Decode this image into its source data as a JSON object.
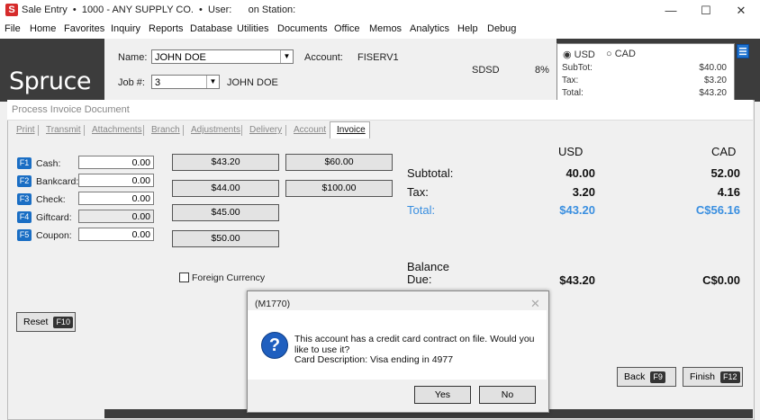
{
  "window": {
    "title": "Sale Entry  •  1000 - ANY SUPPLY CO.  •  User:      on Station:",
    "app_icon": "S",
    "controls": [
      "—",
      "☐",
      "✕"
    ]
  },
  "menu": [
    "File",
    "Home",
    "Favorites",
    "Inquiry",
    "Reports",
    "Database",
    "Utilities",
    "Documents",
    "Office",
    "Memos",
    "Analytics",
    "Help",
    "Debug"
  ],
  "logo": "Spruce",
  "header": {
    "name_label": "Name:",
    "name_value": "JOHN DOE",
    "account_label": "Account:",
    "account_value": "FISERV1",
    "job_label": "Job #:",
    "job_value": "3",
    "job_name": "JOHN DOE",
    "code": "SDSD",
    "tax_rate": "8%"
  },
  "currency": {
    "usd_label": "USD",
    "cad_label": "CAD",
    "selected": "USD",
    "subtot_label": "SubTot:",
    "subtot_value": "$40.00",
    "tax_label": "Tax:",
    "tax_value": "$3.20",
    "total_label": "Total:",
    "total_value": "$43.20"
  },
  "panel": {
    "title": "Process Invoice Document",
    "tabs": [
      "Print",
      "Transmit",
      "Attachments",
      "Branch",
      "Adjustments",
      "Delivery",
      "Account",
      "Invoice"
    ],
    "active_tab": "Invoice"
  },
  "payments": [
    {
      "key": "F1",
      "label": "Cash:",
      "value": "0.00"
    },
    {
      "key": "F2",
      "label": "Bankcard:",
      "value": "0.00"
    },
    {
      "key": "F3",
      "label": "Check:",
      "value": "0.00"
    },
    {
      "key": "F4",
      "label": "Giftcard:",
      "value": "0.00"
    },
    {
      "key": "F5",
      "label": "Coupon:",
      "value": "0.00"
    }
  ],
  "amount_buttons": [
    "$43.20",
    "$60.00",
    "$44.00",
    "$100.00",
    "$45.00",
    "$50.00"
  ],
  "foreign_currency_label": "Foreign Currency",
  "totals": {
    "usd_header": "USD",
    "cad_header": "CAD",
    "subtotal_label": "Subtotal:",
    "subtotal_usd": "40.00",
    "subtotal_cad": "52.00",
    "tax_label": "Tax:",
    "tax_usd": "3.20",
    "tax_cad": "4.16",
    "total_label": "Total:",
    "total_usd": "$43.20",
    "total_cad": "C$56.16",
    "balance_label_1": "Balance",
    "balance_label_2": "Due:",
    "balance_usd": "$43.20",
    "balance_cad": "C$0.00"
  },
  "buttons": {
    "reset": "Reset",
    "reset_key": "F10",
    "back": "Back",
    "back_key": "F9",
    "finish": "Finish",
    "finish_key": "F12"
  },
  "dialog": {
    "title": "(M1770)",
    "line1": "This account has a credit card contract on file.  Would you",
    "line2": "like to use it?",
    "line3": "Card Description: Visa ending in 4977",
    "yes": "Yes",
    "no": "No"
  },
  "colors": {
    "accent_blue": "#3a8fe0",
    "fkey_blue": "#1a6ec4",
    "dark_band": "#3c3c3c"
  }
}
